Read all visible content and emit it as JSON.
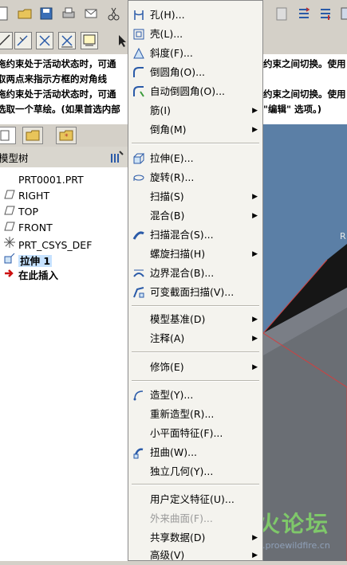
{
  "status_messages": [
    "拖约束处于活动状态时，可通",
    "取两点来指示方框的对角线",
    "拖约束处于活动状态时，可通",
    "选取一个草绘。(如果首选内部"
  ],
  "status_messages_right": [
    "约束之间切换。使用",
    "约束之间切换。使用",
    "\"编辑\" 选项。)"
  ],
  "tree": {
    "header": "模型树",
    "items": [
      {
        "label": "PRT0001.PRT",
        "icon": "part-icon"
      },
      {
        "label": "RIGHT",
        "icon": "datum-plane-icon"
      },
      {
        "label": "TOP",
        "icon": "datum-plane-icon"
      },
      {
        "label": "FRONT",
        "icon": "datum-plane-icon"
      },
      {
        "label": "PRT_CSYS_DEF",
        "icon": "csys-icon"
      },
      {
        "label": "拉伸 1",
        "icon": "extrude-icon"
      },
      {
        "label": "在此插入",
        "icon": "insert-here-icon"
      }
    ]
  },
  "menu": {
    "items": [
      {
        "label": "孔(H)...",
        "icon": "hole-icon",
        "submenu": false
      },
      {
        "label": "壳(L)...",
        "icon": "shell-icon",
        "submenu": false
      },
      {
        "label": "斜度(F)...",
        "icon": "draft-icon",
        "submenu": false
      },
      {
        "label": "倒圆角(O)...",
        "icon": "round-icon",
        "submenu": false
      },
      {
        "label": "自动倒圆角(O)...",
        "icon": "auto-round-icon",
        "submenu": false
      },
      {
        "label": "筋(I)",
        "icon": "",
        "submenu": true
      },
      {
        "label": "倒角(M)",
        "icon": "",
        "submenu": true
      },
      {
        "label": "拉伸(E)...",
        "icon": "extrude-icon",
        "submenu": false
      },
      {
        "label": "旋转(R)...",
        "icon": "revolve-icon",
        "submenu": false
      },
      {
        "label": "扫描(S)",
        "icon": "",
        "submenu": true
      },
      {
        "label": "混合(B)",
        "icon": "",
        "submenu": true
      },
      {
        "label": "扫描混合(S)...",
        "icon": "swept-blend-icon",
        "submenu": false
      },
      {
        "label": "螺旋扫描(H)",
        "icon": "",
        "submenu": true
      },
      {
        "label": "边界混合(B)...",
        "icon": "boundary-blend-icon",
        "submenu": false
      },
      {
        "label": "可变截面扫描(V)...",
        "icon": "var-sweep-icon",
        "submenu": false
      },
      {
        "label": "模型基准(D)",
        "icon": "",
        "submenu": true
      },
      {
        "label": "注释(A)",
        "icon": "",
        "submenu": true
      },
      {
        "label": "修饰(E)",
        "icon": "",
        "submenu": true
      },
      {
        "label": "造型(Y)...",
        "icon": "style-icon",
        "submenu": false
      },
      {
        "label": "重新造型(R)...",
        "icon": "",
        "submenu": false
      },
      {
        "label": "小平面特征(F)...",
        "icon": "",
        "submenu": false
      },
      {
        "label": "扭曲(W)...",
        "icon": "warp-icon",
        "submenu": false
      },
      {
        "label": "独立几何(Y)...",
        "icon": "",
        "submenu": false
      },
      {
        "label": "用户定义特征(U)...",
        "icon": "",
        "submenu": false
      },
      {
        "label": "外来曲面(F)...",
        "icon": "",
        "submenu": false,
        "disabled": true
      },
      {
        "label": "共享数据(D)",
        "icon": "",
        "submenu": true
      },
      {
        "label": "高级(V)",
        "icon": "",
        "submenu": true
      }
    ]
  },
  "graphics": {
    "label_fragment": "R"
  },
  "watermark": {
    "title": "野火论坛",
    "url": "www.proewildfire.cn"
  },
  "colors": {
    "menu_bg": "#f4f3ee",
    "viewport_bg": "#5b7fa6",
    "selection_highlight": "#c6e2ff",
    "watermark_green": "#7fc86a"
  }
}
